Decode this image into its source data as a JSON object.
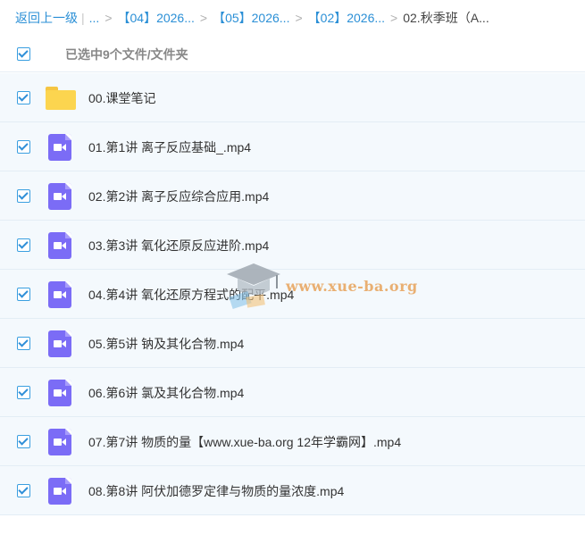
{
  "breadcrumb": {
    "back": "返回上一级",
    "ellipsis": "...",
    "items": [
      "【04】2026...",
      "【05】2026...",
      "【02】2026..."
    ],
    "current": "02.秋季班（A..."
  },
  "selection": {
    "text": "已选中9个文件/文件夹",
    "all_checked": true
  },
  "files": [
    {
      "name": "00.课堂笔记",
      "type": "folder",
      "checked": true
    },
    {
      "name": "01.第1讲 离子反应基础_.mp4",
      "type": "video",
      "checked": true
    },
    {
      "name": "02.第2讲 离子反应综合应用.mp4",
      "type": "video",
      "checked": true
    },
    {
      "name": "03.第3讲 氧化还原反应进阶.mp4",
      "type": "video",
      "checked": true
    },
    {
      "name": "04.第4讲 氧化还原方程式的配平.mp4",
      "type": "video",
      "checked": true
    },
    {
      "name": "05.第5讲 钠及其化合物.mp4",
      "type": "video",
      "checked": true
    },
    {
      "name": "06.第6讲 氯及其化合物.mp4",
      "type": "video",
      "checked": true
    },
    {
      "name": "07.第7讲 物质的量【www.xue-ba.org 12年学霸网】.mp4",
      "type": "video",
      "checked": true
    },
    {
      "name": "08.第8讲 阿伏加德罗定律与物质的量浓度.mp4",
      "type": "video",
      "checked": true
    }
  ],
  "watermark": {
    "text": "www.xue-ba.org"
  },
  "colors": {
    "link": "#2a8fd6",
    "checkbox": "#2f8fd8",
    "video_icon": "#7b6cf6",
    "folder_icon": "#fcd54f",
    "row_bg": "#f4f9fd"
  }
}
